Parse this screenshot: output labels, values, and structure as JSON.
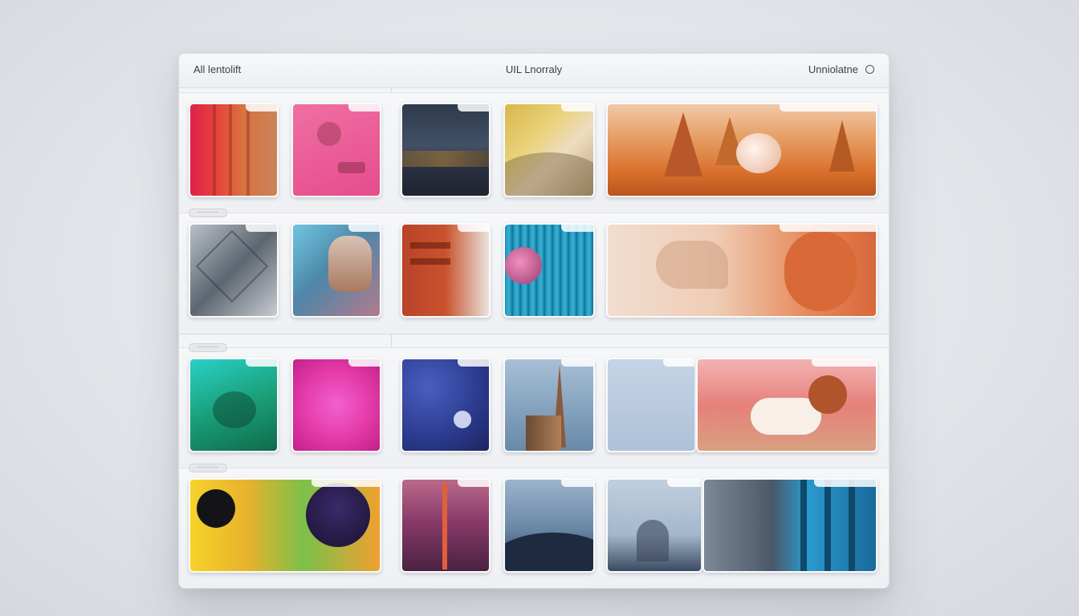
{
  "header": {
    "left_label": "All lentolift",
    "title": "UIL Lnorraly",
    "right_label": "Unniolatne"
  },
  "icons": {
    "right_circle": "circle-icon",
    "row_handle": "grip-handle-icon"
  },
  "colors": {
    "panel_bg": "#f3f4f6",
    "accent_glow": "#ff788c"
  },
  "rows": [
    {
      "thumbnails": [
        {
          "name": "photo-red-abstract"
        },
        {
          "name": "photo-pink-plant"
        },
        {
          "name": "photo-dark-hills"
        },
        {
          "name": "photo-gold-wave"
        },
        {
          "name": "photo-autumn-trees"
        }
      ]
    },
    {
      "thumbnails": [
        {
          "name": "photo-geometric-gray"
        },
        {
          "name": "photo-statue-face"
        },
        {
          "name": "photo-red-building"
        },
        {
          "name": "photo-blue-curtain"
        },
        {
          "name": "photo-orange-sculpture"
        }
      ]
    },
    {
      "thumbnails": [
        {
          "name": "photo-teal-creature"
        },
        {
          "name": "photo-magenta-fur"
        },
        {
          "name": "photo-blue-orb"
        },
        {
          "name": "photo-spire-tower"
        },
        {
          "name": "photo-pale-blue"
        },
        {
          "name": "photo-sleeping-cat"
        }
      ]
    },
    {
      "thumbnails": [
        {
          "name": "photo-colorful-creature"
        },
        {
          "name": "photo-purple-tower"
        },
        {
          "name": "photo-dusk-hills"
        },
        {
          "name": "photo-blue-landscape"
        },
        {
          "name": "photo-blue-forest"
        }
      ]
    }
  ]
}
